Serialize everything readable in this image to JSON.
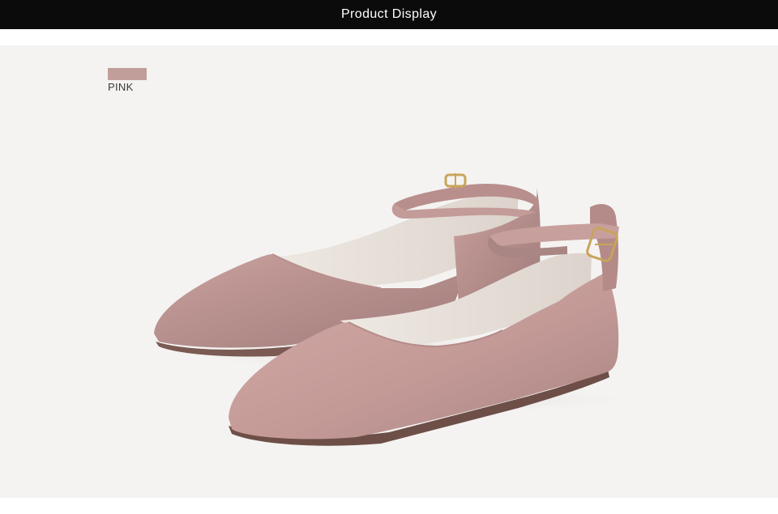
{
  "header": {
    "title": "Product Display"
  },
  "product": {
    "color_name": "PINK",
    "swatch_color": "#c29e9b",
    "insole_brand_text": ""
  },
  "colors": {
    "header_bg": "#0b0b0b",
    "header_text": "#ffffff",
    "stage_bg": "#f4f3f2",
    "suede": "#c89e9b",
    "suede_shadow": "#a77f7d",
    "lining": "#ece7e1",
    "buckle": "#c9a45b"
  }
}
